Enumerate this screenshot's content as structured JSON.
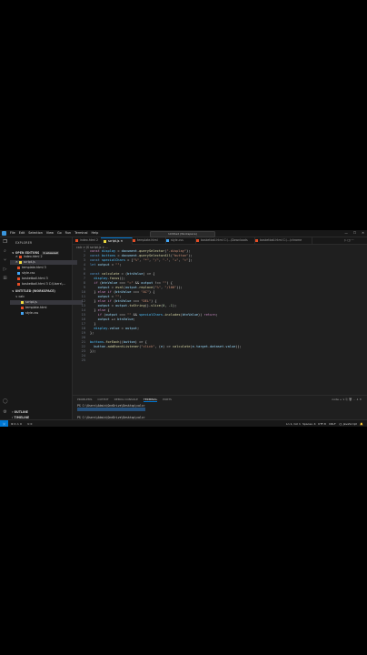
{
  "titlebar": {
    "menu": [
      "File",
      "Edit",
      "Selection",
      "View",
      "Go",
      "Run",
      "Terminal",
      "Help"
    ],
    "search": "Untitled (Workspace)",
    "controls": [
      "—",
      "☐",
      "✕"
    ]
  },
  "sidebar": {
    "header": "EXPLORER",
    "open_editors_label": "OPEN EDITORS",
    "unsaved_badge": "1 unsaved",
    "open_editors": [
      {
        "name": "index.html 2",
        "icon_color": "#e44d26"
      },
      {
        "name": "script.js",
        "icon_color": "#f1dd3f",
        "selected": true
      },
      {
        "name": "template.html 3",
        "icon_color": "#e44d26"
      },
      {
        "name": "style.css",
        "icon_color": "#42a5f5"
      },
      {
        "name": "basketball.html 3",
        "icon_color": "#e44d26"
      },
      {
        "name": "basketball.html 3 C:\\Users\\...",
        "icon_color": "#e44d26"
      }
    ],
    "workspace_label": "UNTITLED (WORKSPACE)",
    "workspace": [
      {
        "name": "calc",
        "folder": true
      },
      {
        "name": "script.js",
        "icon_color": "#f1dd3f",
        "selected": true
      },
      {
        "name": "template.html",
        "icon_color": "#e44d26"
      },
      {
        "name": "style.css",
        "icon_color": "#42a5f5"
      }
    ],
    "outline_label": "OUTLINE",
    "timeline_label": "TIMELINE"
  },
  "tabs": [
    {
      "label": "index.html 2",
      "color": "#e44d26"
    },
    {
      "label": "script.js",
      "color": "#f1dd3f",
      "active": true
    },
    {
      "label": "template.html",
      "color": "#e44d26"
    },
    {
      "label": "style.css",
      "color": "#42a5f5"
    },
    {
      "label": "basketball.html C:\\...\\Downloads",
      "color": "#e44d26"
    },
    {
      "label": "basketball.html C:\\...\\chrome",
      "color": "#e44d26"
    }
  ],
  "breadcrumb": "calc > JS script.js > ...",
  "editor": {
    "line_numbers": [
      "1",
      "2",
      "3",
      "4",
      "5",
      "6",
      "7",
      "8",
      "9",
      "10",
      "11",
      "12",
      "13",
      "14",
      "15",
      "16",
      "17",
      "18",
      "19",
      "20",
      "21",
      "22",
      "23",
      "24",
      "25"
    ]
  },
  "panel": {
    "tabs": [
      "PROBLEMS",
      "OUTPUT",
      "DEBUG CONSOLE",
      "TERMINAL",
      "PORTS"
    ],
    "active_tab": "TERMINAL",
    "right": "node  + ∨  ⎘  🗑  ···  ∧  ✕",
    "terminal_lines": [
      "PS C:\\Users\\Admin\\OneDrive\\Desktop\\calc>",
      "                                        ",
      "",
      "PS C:\\Users\\Admin\\OneDrive\\Desktop\\calc>"
    ]
  },
  "status": {
    "left_items": [
      "⊗ 0 ⚠ 0",
      "⊙ 0"
    ],
    "right_items": [
      "Ln 1, Col 1",
      "Spaces: 4",
      "UTF-8",
      "CRLF",
      "{} JavaScript",
      "🔔"
    ]
  },
  "colors": {
    "accent": "#0078d4",
    "editor_bg": "#1f1f1f",
    "chrome_bg": "#181818"
  }
}
